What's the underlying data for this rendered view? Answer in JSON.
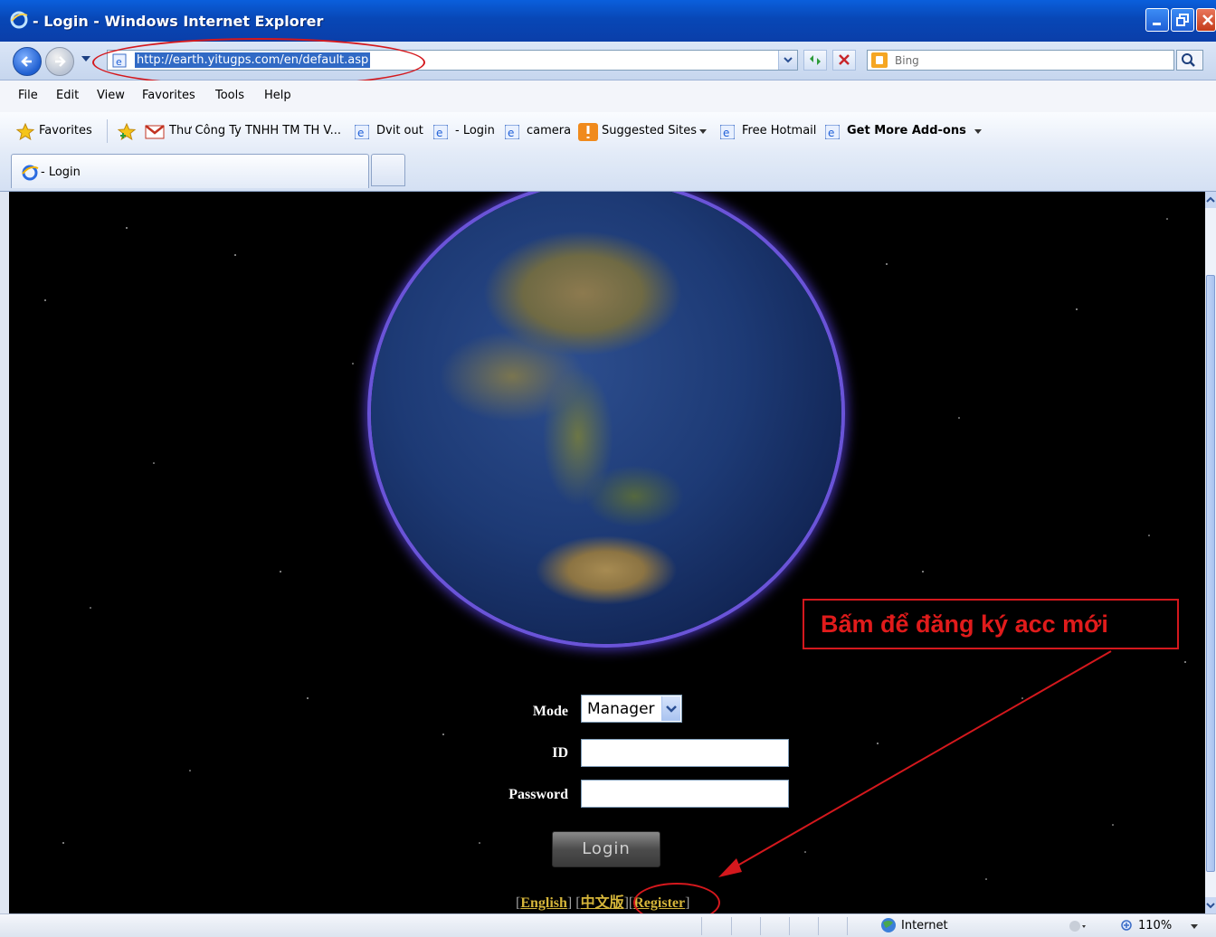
{
  "window": {
    "title": "- Login - Windows Internet Explorer"
  },
  "address_bar": {
    "url": "http://earth.yitugps.com/en/default.asp"
  },
  "search": {
    "placeholder": "Bing"
  },
  "menu": {
    "items": [
      "File",
      "Edit",
      "View",
      "Favorites",
      "Tools",
      "Help"
    ]
  },
  "favorites_bar": {
    "favorites_label": "Favorites",
    "items": [
      "Thư Công Ty TNHH TM TH V...",
      "Dvit out",
      "- Login",
      "camera",
      "Suggested Sites",
      "Free Hotmail",
      "Get More Add-ons"
    ]
  },
  "tabs": [
    {
      "label": "- Login"
    }
  ],
  "login_form": {
    "mode_label": "Mode",
    "mode_value": "Manager",
    "id_label": "ID",
    "password_label": "Password",
    "login_button": "Login",
    "links": {
      "english": "English",
      "chinese": "中文版",
      "register": "Register"
    }
  },
  "annotation": {
    "text": "Bấm để đăng ký acc mới",
    "color": "#e01b1b"
  },
  "status_bar": {
    "zone": "Internet",
    "zoom": "110%"
  }
}
